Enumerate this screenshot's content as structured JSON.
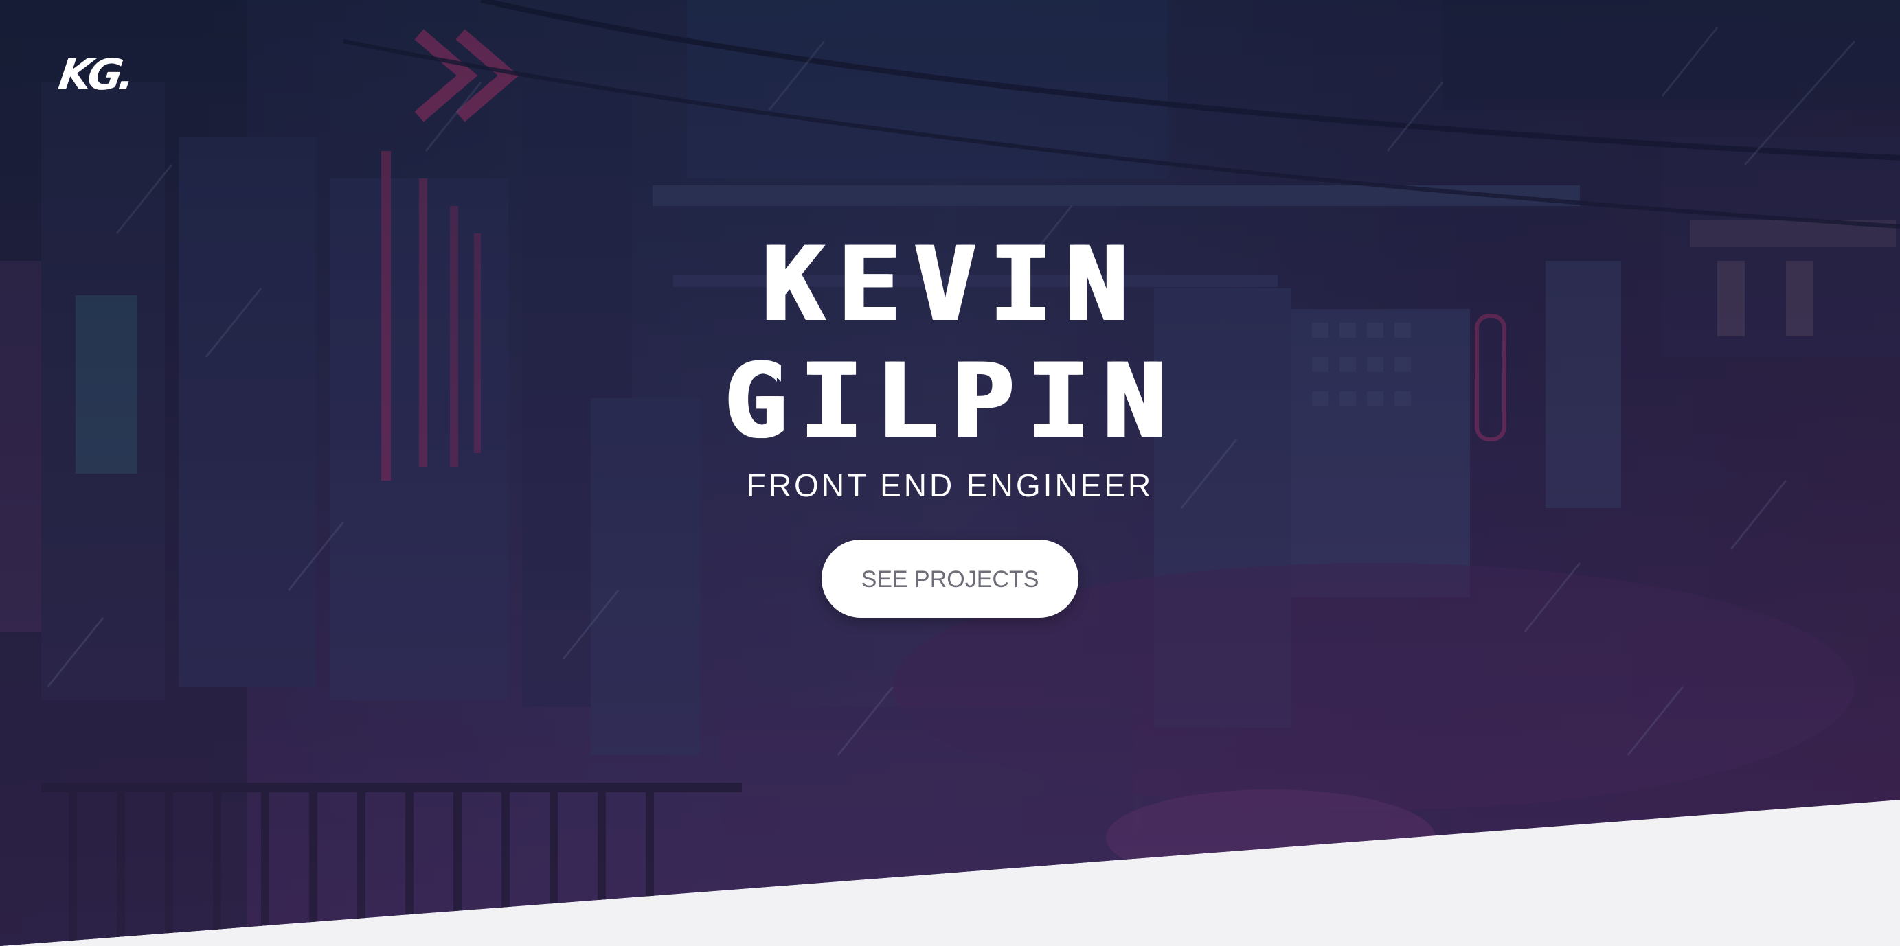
{
  "brand": {
    "logo_text": "KG."
  },
  "hero": {
    "title_line1": "KEVIN",
    "title_line2": "GILPIN",
    "subtitle": "FRONT END ENGINEER",
    "cta_label": "SEE PROJECTS"
  },
  "colors": {
    "hero_dark": "#1d2340",
    "hero_blue": "#35426b",
    "hero_purple": "#3a2448",
    "neon_pink": "#c23a78",
    "page_bg": "#f2f2f4",
    "button_bg": "#ffffff",
    "button_text": "#6e6e78"
  }
}
